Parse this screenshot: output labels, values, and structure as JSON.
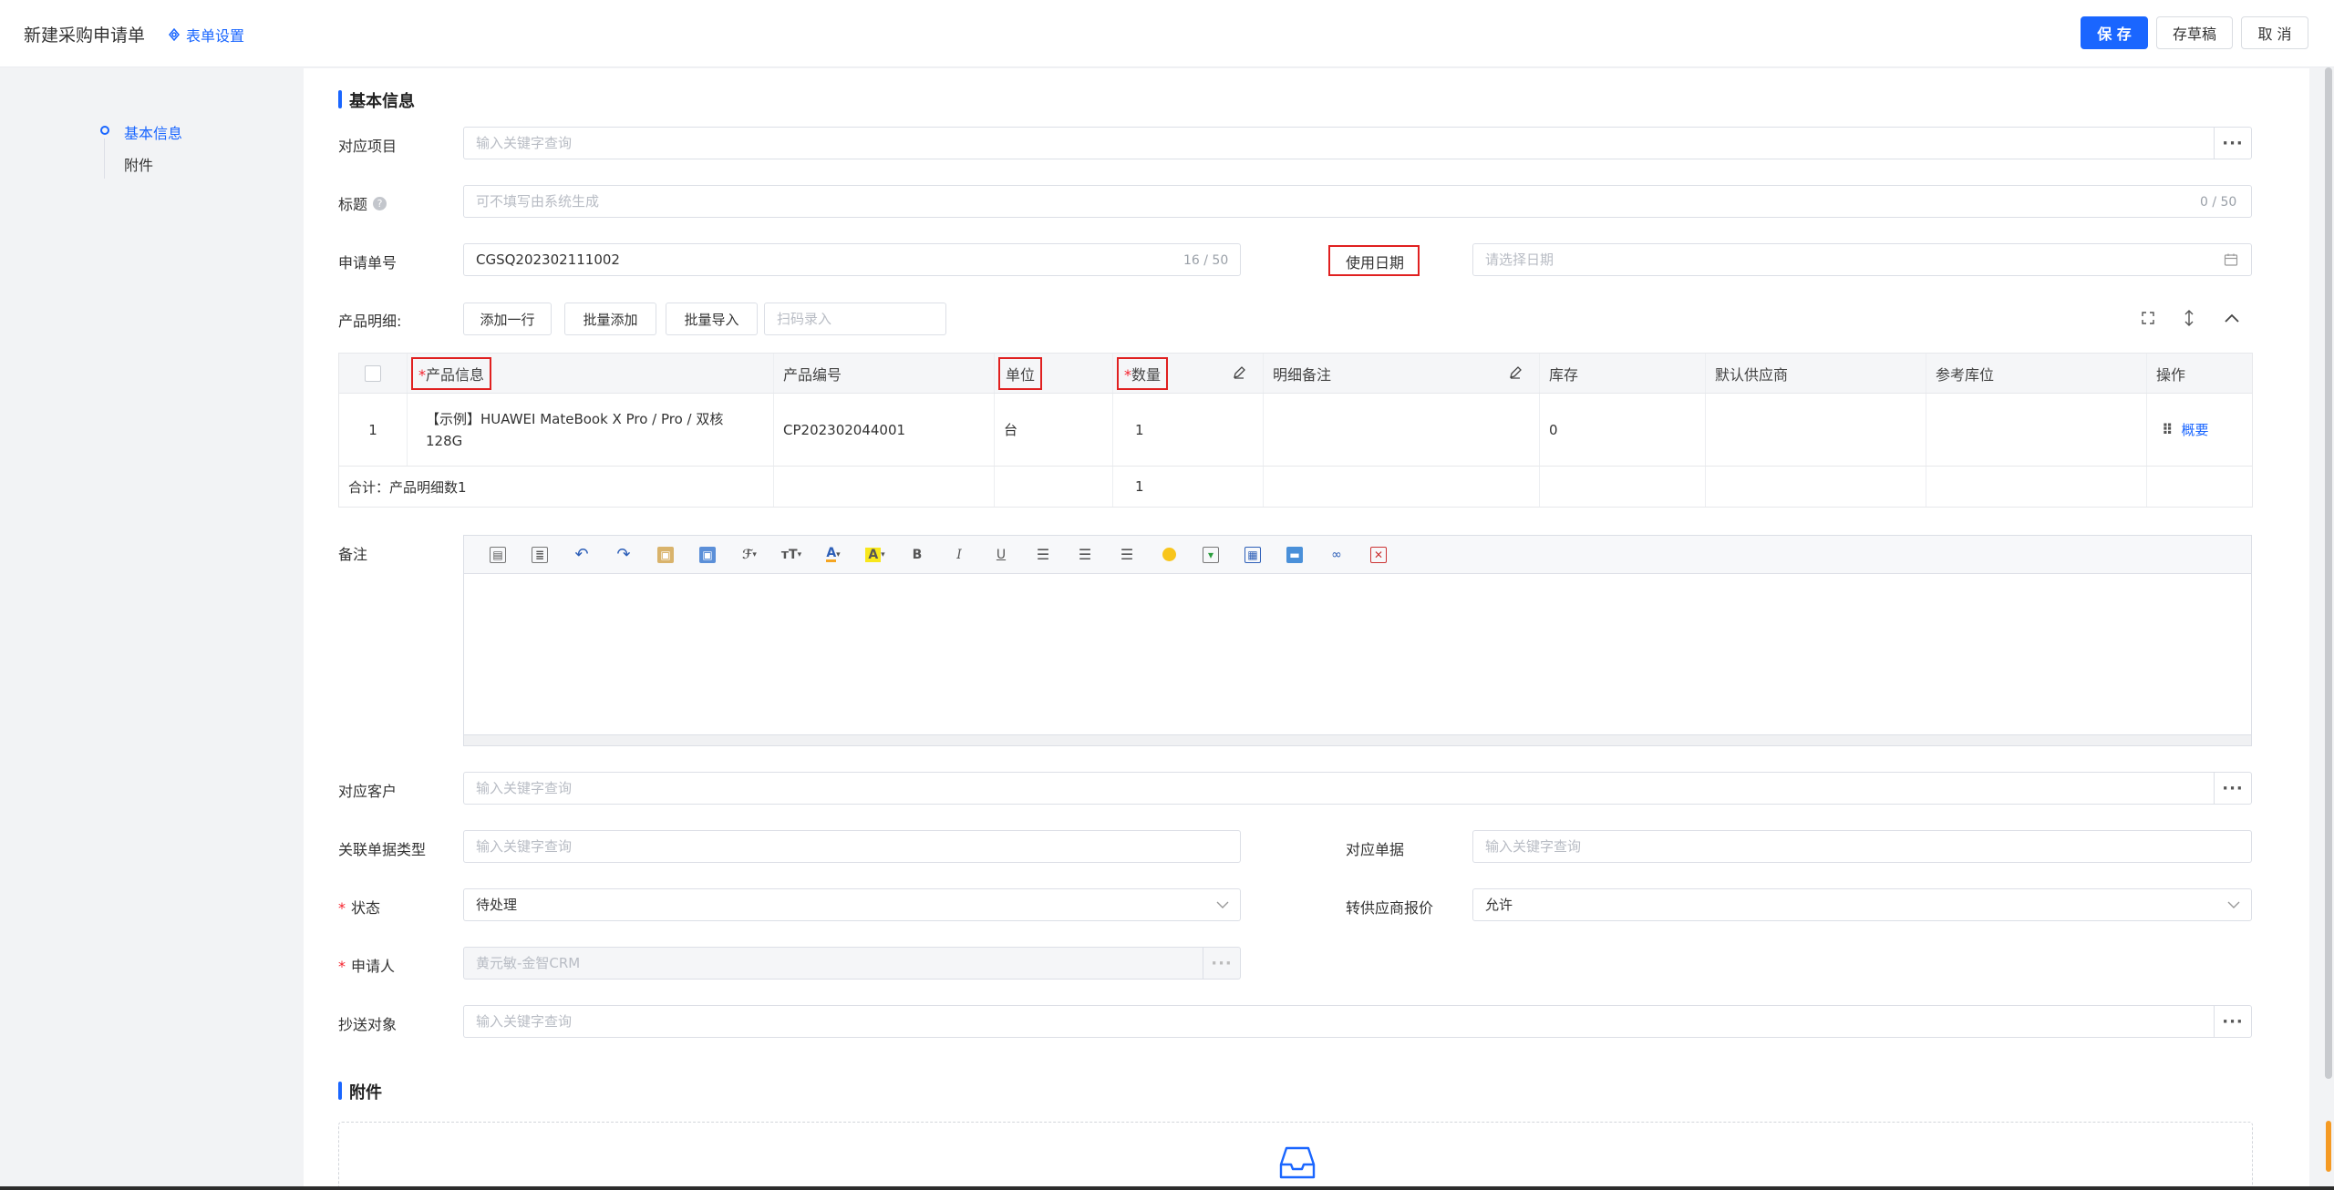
{
  "header": {
    "title": "新建采购申请单",
    "form_settings": "表单设置",
    "save": "保 存",
    "draft": "存草稿",
    "cancel": "取 消"
  },
  "nav": {
    "items": [
      {
        "label": "基本信息"
      },
      {
        "label": "附件"
      }
    ]
  },
  "section_basic": "基本信息",
  "fields": {
    "project": {
      "label": "对应项目",
      "placeholder": "输入关键字查询"
    },
    "title": {
      "label": "标题",
      "placeholder": "可不填写由系统生成",
      "counter": "0 / 50"
    },
    "request_no": {
      "label": "申请单号",
      "value": "CGSQ202302111002",
      "counter": "16 / 50"
    },
    "use_date": {
      "label": "使用日期",
      "placeholder": "请选择日期"
    },
    "product_detail": {
      "label": "产品明细:"
    },
    "remark": {
      "label": "备注"
    },
    "customer": {
      "label": "对应客户",
      "placeholder": "输入关键字查询"
    },
    "related_type": {
      "label": "关联单据类型",
      "placeholder": "输入关键字查询"
    },
    "related_doc": {
      "label": "对应单据",
      "placeholder": "输入关键字查询"
    },
    "status": {
      "label": "状态",
      "value": "待处理"
    },
    "supplier_quote": {
      "label": "转供应商报价",
      "value": "允许"
    },
    "applicant": {
      "label": "申请人",
      "value": "黄元敏-金智CRM"
    },
    "cc": {
      "label": "抄送对象",
      "placeholder": "输入关键字查询"
    }
  },
  "detail_buttons": {
    "add_row": "添加一行",
    "batch_add": "批量添加",
    "batch_import": "批量导入",
    "scan_placeholder": "扫码录入"
  },
  "table": {
    "headers": [
      "产品信息",
      "产品编号",
      "单位",
      "数量",
      "明细备注",
      "库存",
      "默认供应商",
      "参考库位",
      "操作"
    ],
    "rows": [
      {
        "index": "1",
        "product": "【示例】HUAWEI MateBook X Pro / Pro / 双核",
        "product_line2": "128G",
        "code": "CP202302044001",
        "unit": "台",
        "qty": "1",
        "note": "",
        "stock": "0",
        "supplier": "",
        "location": "",
        "action": "概要"
      }
    ],
    "footer_label": "合计：产品明细数1",
    "footer_qty": "1"
  },
  "section_attach": "附件",
  "colors": {
    "accent": "#1a66ff",
    "highlight": "#e02020"
  }
}
